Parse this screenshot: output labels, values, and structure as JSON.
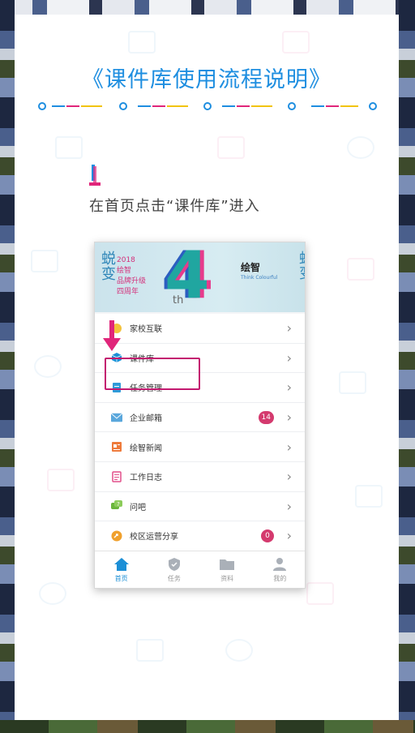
{
  "title": "《课件库使用流程说明》",
  "step": {
    "text": "在首页点击“课件库”进入"
  },
  "phone": {
    "banner": {
      "side_text": "蜕变",
      "year_lines": [
        "2018",
        "绘智",
        "品牌升级",
        "四周年"
      ],
      "big_number": "4",
      "suffix": "th",
      "logo_text": "绘智",
      "logo_sub": "Think Colourful",
      "right_text": "蜕变"
    },
    "menu": [
      {
        "label": "家校互联",
        "icon": "home-school-icon",
        "color": "#f3c23c"
      },
      {
        "label": "课件库",
        "icon": "cube-icon",
        "color": "#1c8fd6"
      },
      {
        "label": "任务管理",
        "icon": "clipboard-icon",
        "color": "#2f9ad8"
      },
      {
        "label": "企业邮箱",
        "icon": "mail-icon",
        "color": "#5aa7dc",
        "badge": "14"
      },
      {
        "label": "绘智新闻",
        "icon": "news-icon",
        "color": "#ee7a3a"
      },
      {
        "label": "工作日志",
        "icon": "log-icon",
        "color": "#e24f8a"
      },
      {
        "label": "问吧",
        "icon": "question-chat-icon",
        "color": "#6ab63c"
      },
      {
        "label": "校区运营分享",
        "icon": "share-icon",
        "color": "#f0a02c",
        "badge": "0"
      }
    ],
    "tabs": [
      {
        "label": "首页",
        "icon": "home-icon",
        "active": true
      },
      {
        "label": "任务",
        "icon": "shield-check-icon",
        "active": false
      },
      {
        "label": "资料",
        "icon": "folder-icon",
        "active": false
      },
      {
        "label": "我的",
        "icon": "user-icon",
        "active": false
      }
    ]
  },
  "colors": {
    "title": "#1e8ee0",
    "highlight": "#c3196f",
    "accent_pink": "#e0257a",
    "accent_yellow": "#f1c40f",
    "accent_blue": "#1e8ee0"
  }
}
